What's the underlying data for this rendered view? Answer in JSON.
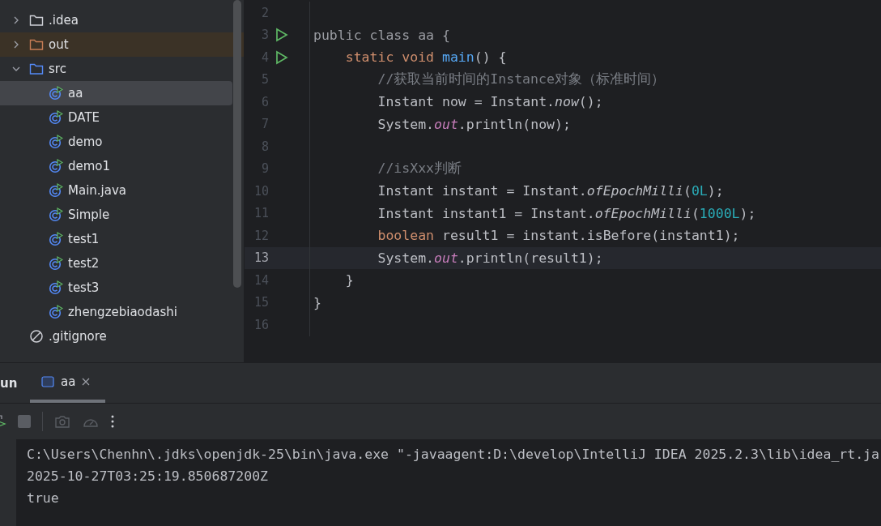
{
  "project_tree": {
    "items": [
      {
        "label": ".idea",
        "kind": "folder",
        "expanded": false,
        "selected": false
      },
      {
        "label": "out",
        "kind": "excluded-folder",
        "expanded": false,
        "selected": false
      },
      {
        "label": "src",
        "kind": "source-folder",
        "expanded": true,
        "selected": false,
        "children": [
          {
            "label": "aa",
            "kind": "java-class",
            "selected": true
          },
          {
            "label": "DATE",
            "kind": "java-class",
            "selected": false
          },
          {
            "label": "demo",
            "kind": "java-class",
            "selected": false
          },
          {
            "label": "demo1",
            "kind": "java-class",
            "selected": false
          },
          {
            "label": "Main.java",
            "kind": "java-class",
            "selected": false
          },
          {
            "label": "Simple",
            "kind": "java-class",
            "selected": false
          },
          {
            "label": "test1",
            "kind": "java-class",
            "selected": false
          },
          {
            "label": "test2",
            "kind": "java-class",
            "selected": false
          },
          {
            "label": "test3",
            "kind": "java-class",
            "selected": false
          },
          {
            "label": "zhengzebiaodashi",
            "kind": "java-class",
            "selected": false
          }
        ]
      },
      {
        "label": ".gitignore",
        "kind": "ignore-file",
        "selected": false
      }
    ]
  },
  "editor": {
    "lines": [
      {
        "number": "2",
        "runnable": false,
        "current": false
      },
      {
        "number": "3",
        "runnable": true,
        "current": false,
        "tokens": [
          {
            "text": "public class aa {",
            "kind": "dimmed"
          }
        ]
      },
      {
        "number": "4",
        "runnable": true,
        "current": false,
        "tokens": [
          {
            "text": "    static void ",
            "kind": "keyword"
          },
          {
            "text": "main",
            "kind": "declaration"
          },
          {
            "text": "() {",
            "kind": "plain"
          }
        ]
      },
      {
        "number": "5",
        "runnable": false,
        "current": false,
        "tokens": [
          {
            "text": "        //获取当前时间的Instance对象（标准时间）",
            "kind": "comment"
          }
        ]
      },
      {
        "number": "6",
        "runnable": false,
        "current": false,
        "tokens": [
          {
            "text": "        Instant now = Instant.",
            "kind": "plain"
          },
          {
            "text": "now",
            "kind": "static-call"
          },
          {
            "text": "();",
            "kind": "plain"
          }
        ]
      },
      {
        "number": "7",
        "runnable": false,
        "current": false,
        "tokens": [
          {
            "text": "        System.",
            "kind": "plain"
          },
          {
            "text": "out",
            "kind": "static-field"
          },
          {
            "text": ".println(now);",
            "kind": "plain"
          }
        ]
      },
      {
        "number": "8",
        "runnable": false,
        "current": false
      },
      {
        "number": "9",
        "runnable": false,
        "current": false,
        "tokens": [
          {
            "text": "        //isXxx判断",
            "kind": "comment"
          }
        ]
      },
      {
        "number": "10",
        "runnable": false,
        "current": false,
        "tokens": [
          {
            "text": "        Instant instant = Instant.",
            "kind": "plain"
          },
          {
            "text": "ofEpochMilli",
            "kind": "static-call"
          },
          {
            "text": "(",
            "kind": "plain"
          },
          {
            "text": "0L",
            "kind": "number"
          },
          {
            "text": ");",
            "kind": "plain"
          }
        ]
      },
      {
        "number": "11",
        "runnable": false,
        "current": false,
        "tokens": [
          {
            "text": "        Instant instant1 = Instant.",
            "kind": "plain"
          },
          {
            "text": "ofEpochMilli",
            "kind": "static-call"
          },
          {
            "text": "(",
            "kind": "plain"
          },
          {
            "text": "1000L",
            "kind": "number"
          },
          {
            "text": ");",
            "kind": "plain"
          }
        ]
      },
      {
        "number": "12",
        "runnable": false,
        "current": false,
        "tokens": [
          {
            "text": "        boolean ",
            "kind": "keyword"
          },
          {
            "text": "result1 = instant.isBefore(instant1);",
            "kind": "plain"
          }
        ]
      },
      {
        "number": "13",
        "runnable": false,
        "current": true,
        "tokens": [
          {
            "text": "        System.",
            "kind": "plain"
          },
          {
            "text": "out",
            "kind": "static-field"
          },
          {
            "text": ".println(result1);",
            "kind": "plain"
          }
        ]
      },
      {
        "number": "14",
        "runnable": false,
        "current": false,
        "tokens": [
          {
            "text": "    }",
            "kind": "plain"
          }
        ]
      },
      {
        "number": "15",
        "runnable": false,
        "current": false,
        "tokens": [
          {
            "text": "}",
            "kind": "plain"
          }
        ]
      },
      {
        "number": "16",
        "runnable": false,
        "current": false
      }
    ]
  },
  "run_panel": {
    "title": "un",
    "tabs": [
      {
        "label": "aa",
        "selected": true
      }
    ],
    "console": [
      "C:\\Users\\Chenhn\\.jdks\\openjdk-25\\bin\\java.exe \"-javaagent:D:\\develop\\IntelliJ IDEA 2025.2.3\\lib\\idea_rt.ja",
      "2025-10-27T03:25:19.850687200Z",
      "true"
    ]
  }
}
